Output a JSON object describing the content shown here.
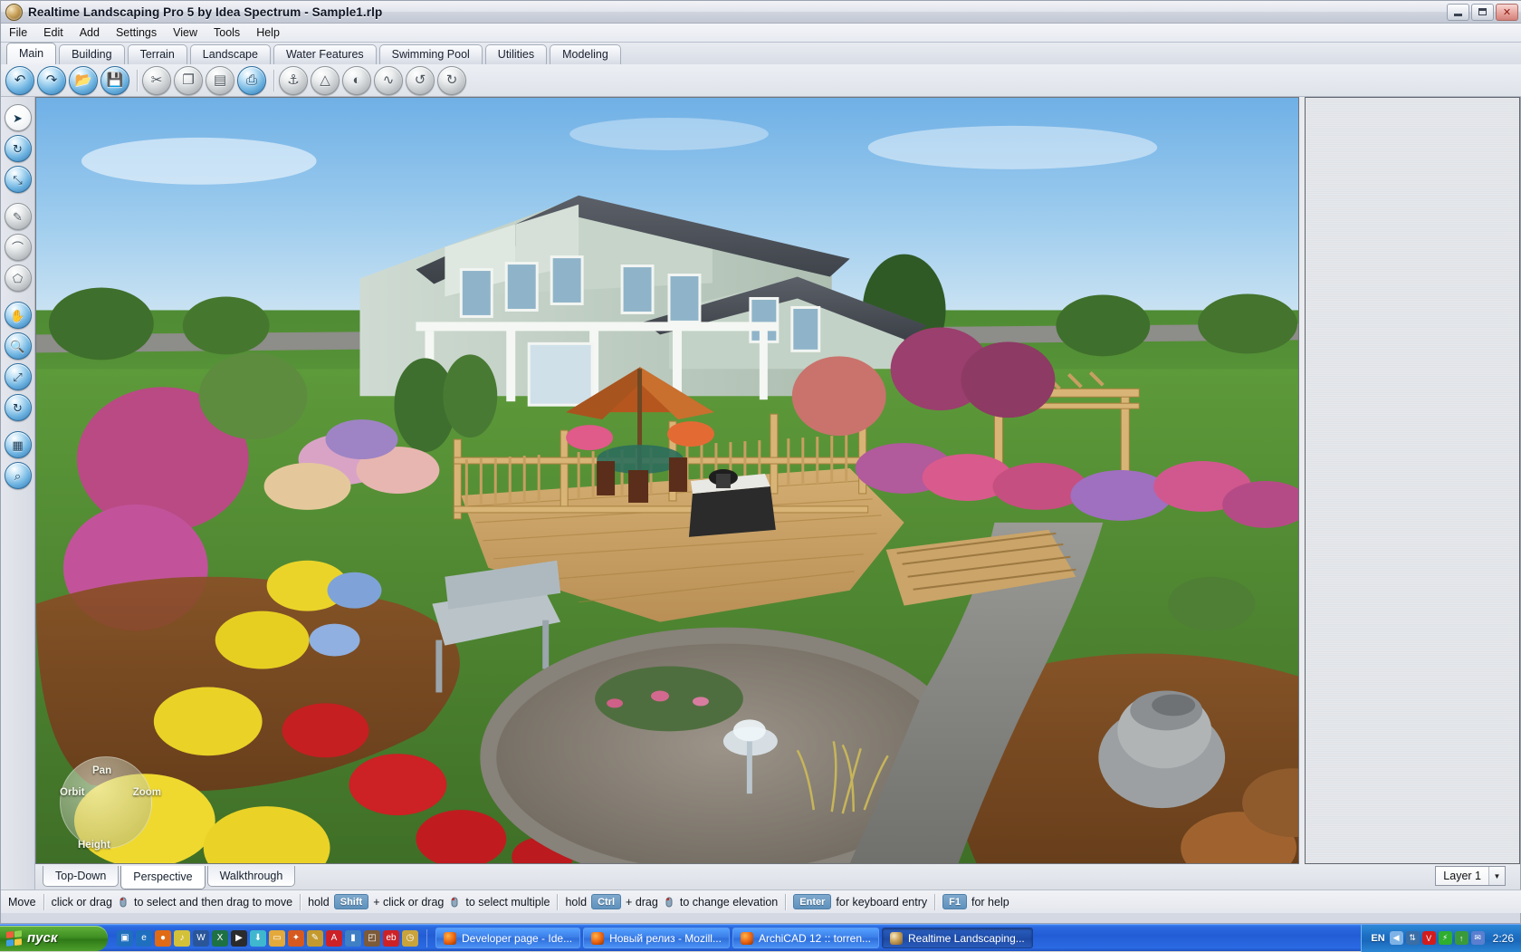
{
  "window": {
    "title": "Realtime Landscaping Pro 5 by Idea Spectrum - Sample1.rlp",
    "app_icon": "app-logo-icon",
    "minimize_label": "Minimize",
    "maximize_label": "Restore",
    "close_label": "Close"
  },
  "menubar": {
    "items": [
      {
        "label": "File"
      },
      {
        "label": "Edit"
      },
      {
        "label": "Add"
      },
      {
        "label": "Settings"
      },
      {
        "label": "View"
      },
      {
        "label": "Tools"
      },
      {
        "label": "Help"
      }
    ]
  },
  "ribbon": {
    "tabs": [
      {
        "label": "Main",
        "active": true
      },
      {
        "label": "Building",
        "active": false
      },
      {
        "label": "Terrain",
        "active": false
      },
      {
        "label": "Landscape",
        "active": false
      },
      {
        "label": "Water Features",
        "active": false
      },
      {
        "label": "Swimming Pool",
        "active": false
      },
      {
        "label": "Utilities",
        "active": false
      },
      {
        "label": "Modeling",
        "active": false
      }
    ]
  },
  "toolbar": {
    "buttons": [
      {
        "name": "undo-icon",
        "glyph": "↶",
        "style": "blue"
      },
      {
        "name": "redo-icon",
        "glyph": "↷",
        "style": "blue"
      },
      {
        "name": "open-file-icon",
        "glyph": "📂",
        "style": "blue"
      },
      {
        "name": "save-icon",
        "glyph": "💾",
        "style": "blue"
      },
      {
        "name": "cut-icon",
        "glyph": "✂",
        "style": "gray"
      },
      {
        "name": "copy-icon",
        "glyph": "❐",
        "style": "gray"
      },
      {
        "name": "paste-icon",
        "glyph": "▤",
        "style": "gray"
      },
      {
        "name": "print-icon",
        "glyph": "⎙",
        "style": "blue"
      },
      {
        "name": "align-ground-icon",
        "glyph": "⚓",
        "style": "gray"
      },
      {
        "name": "flatten-icon",
        "glyph": "△",
        "style": "gray"
      },
      {
        "name": "mirror-icon",
        "glyph": "◐",
        "style": "gray"
      },
      {
        "name": "smooth-icon",
        "glyph": "∿",
        "style": "gray"
      },
      {
        "name": "rotate-left-icon",
        "glyph": "↺",
        "style": "gray"
      },
      {
        "name": "rotate-right-icon",
        "glyph": "↻",
        "style": "gray"
      }
    ]
  },
  "tool_rail": {
    "buttons": [
      {
        "name": "select-arrow-tool",
        "glyph": "➤",
        "style": "white"
      },
      {
        "name": "rotate-tool",
        "glyph": "↻",
        "style": "blue"
      },
      {
        "name": "scale-tool",
        "glyph": "⤡",
        "style": "blue"
      },
      {
        "name": "paint-tool",
        "glyph": "✎",
        "style": "gray"
      },
      {
        "name": "curve-tool",
        "glyph": "⌒",
        "style": "gray"
      },
      {
        "name": "region-tool",
        "glyph": "⬠",
        "style": "gray"
      },
      {
        "name": "pan-hand-tool",
        "glyph": "✋",
        "style": "blue"
      },
      {
        "name": "zoom-magnifier-tool",
        "glyph": "🔍",
        "style": "blue"
      },
      {
        "name": "zoom-extents-tool",
        "glyph": "⤢",
        "style": "blue"
      },
      {
        "name": "orbit-tool",
        "glyph": "↻",
        "style": "blue"
      },
      {
        "name": "grid-terrain-tool",
        "glyph": "▦",
        "style": "blue"
      },
      {
        "name": "measure-tool",
        "glyph": "⌕",
        "style": "blue"
      }
    ]
  },
  "viewport": {
    "scene_description": "3D rendered landscape design: two-story light-green house with gray shingle roof, wooden deck with railing, patio umbrella, table and chairs, flower beds with pink, yellow, red and purple blooms, a metal garden bench, a rock-lined pond with fountain, pergola, stone walkway and lawn.",
    "navigation_gizmo": {
      "orbit_label": "Orbit",
      "zoom_label": "Zoom",
      "pan_label": "Pan",
      "height_label": "Height"
    }
  },
  "view_tabs": {
    "tabs": [
      {
        "label": "Top-Down",
        "active": false
      },
      {
        "label": "Perspective",
        "active": true
      },
      {
        "label": "Walkthrough",
        "active": false
      }
    ],
    "layer_selector": {
      "value": "Layer 1",
      "arrow": "▼"
    }
  },
  "statusbar": {
    "mode": "Move",
    "hints": [
      {
        "prefix": "click or drag",
        "mouse": true,
        "suffix": "to select and then drag to move"
      },
      {
        "prefix": "hold",
        "key": "Shift",
        "mid": "+ click or drag",
        "mouse": true,
        "suffix": "to select multiple"
      },
      {
        "prefix": "hold",
        "key": "Ctrl",
        "mid": "+ drag",
        "mouse": true,
        "suffix": "to change elevation"
      },
      {
        "key": "Enter",
        "suffix": "for keyboard entry"
      },
      {
        "key": "F1",
        "suffix": "for help"
      }
    ]
  },
  "taskbar": {
    "start_label": "пуск",
    "quicklaunch": [
      {
        "name": "show-desktop-icon",
        "glyph": "▣",
        "color": "#1f6fbf"
      },
      {
        "name": "internet-explorer-icon",
        "glyph": "e",
        "color": "#1f6fbf"
      },
      {
        "name": "firefox-icon",
        "glyph": "●",
        "color": "#e06b14"
      },
      {
        "name": "winamp-icon",
        "glyph": "♪",
        "color": "#d4c13a"
      },
      {
        "name": "word-icon",
        "glyph": "W",
        "color": "#2a5699"
      },
      {
        "name": "excel-icon",
        "glyph": "X",
        "color": "#1e7145"
      },
      {
        "name": "media-player-icon",
        "glyph": "▶",
        "color": "#2b2b2b"
      },
      {
        "name": "downloader-icon",
        "glyph": "⬇",
        "color": "#3fb7cf"
      },
      {
        "name": "folder-icon",
        "glyph": "▭",
        "color": "#e3a93a"
      },
      {
        "name": "utility-icon",
        "glyph": "✦",
        "color": "#d65a1f"
      },
      {
        "name": "notes-icon",
        "glyph": "✎",
        "color": "#c49a2e"
      },
      {
        "name": "acrobat-icon",
        "glyph": "A",
        "color": "#cc2127"
      },
      {
        "name": "battery-icon",
        "glyph": "▮",
        "color": "#3f7fc4"
      },
      {
        "name": "photo-icon",
        "glyph": "◰",
        "color": "#7c5a3a"
      },
      {
        "name": "ebay-icon",
        "glyph": "eb",
        "color": "#cc2127"
      },
      {
        "name": "clock-icon",
        "glyph": "◷",
        "color": "#c9a33c"
      }
    ],
    "tasks": [
      {
        "label": "Developer page - Ide...",
        "icon": "firefox-icon",
        "active": false
      },
      {
        "label": "Новый релиз - Mozill...",
        "icon": "firefox-icon",
        "active": false
      },
      {
        "label": "ArchiCAD 12 :: torren...",
        "icon": "firefox-icon",
        "active": false
      },
      {
        "label": "Realtime Landscaping...",
        "icon": "app-logo-icon",
        "active": true
      }
    ],
    "tray": {
      "language": "EN",
      "icons": [
        {
          "name": "tray-arrow-icon",
          "glyph": "◀",
          "color": "#7fb3e6"
        },
        {
          "name": "network-icon",
          "glyph": "⇅",
          "color": "#3a6ea5"
        },
        {
          "name": "antivirus-icon",
          "glyph": "V",
          "color": "#d21c1c"
        },
        {
          "name": "flash-icon",
          "glyph": "⚡",
          "color": "#2fae2f"
        },
        {
          "name": "update-icon",
          "glyph": "↑",
          "color": "#3a9a3a"
        },
        {
          "name": "mail-icon",
          "glyph": "✉",
          "color": "#5a7fd0"
        }
      ],
      "clock": "2:26"
    }
  },
  "colors": {
    "accent_blue": "#2f74ad",
    "titlebar": "#e2e5ec",
    "chrome": "#d6dae2",
    "taskbar_blue": "#235dd6",
    "start_green": "#3f8f23",
    "key_badge": "#5f92bd"
  }
}
